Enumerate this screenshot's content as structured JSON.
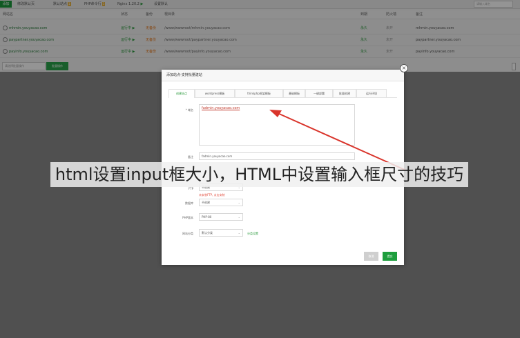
{
  "toolbar": {
    "add_label": "添加",
    "modify_label": "修改默认页",
    "default_site_label": "默认站点",
    "default_site_badge": "1",
    "php_cli_label": "PHP命令行",
    "php_cli_badge": "1",
    "nginx_label": "Nginx 1.20.2",
    "nginx_status": "▶",
    "set_default_label": "设置默认",
    "search_placeholder": "请输入域名"
  },
  "table": {
    "headers": {
      "site": "网站名",
      "status": "状态",
      "backup": "备份",
      "root": "根目录",
      "expire": "到期",
      "firewall": "防火墙",
      "remark": "备注"
    },
    "rows": [
      {
        "site": "mhmin.youyacao.com",
        "status": "运行中 ▶",
        "backup": "无备份",
        "root": "/www/wwwroot/mhmin.youyacao.com",
        "expire": "永久",
        "firewall": "未开",
        "remark": "mhmin.youyacao.com"
      },
      {
        "site": "paypartner.youyacao.com",
        "status": "运行中 ▶",
        "backup": "无备份",
        "root": "/www/wwwroot/paypartner.youyacao.com",
        "expire": "永久",
        "firewall": "未开",
        "remark": "paypartner.youyacao.com"
      },
      {
        "site": "payinfo.youyacao.com",
        "status": "运行中 ▶",
        "backup": "无备份",
        "root": "/www/wwwroot/payinfo.youyacao.com",
        "expire": "永久",
        "firewall": "未开",
        "remark": "payinfo.youyacao.com"
      }
    ]
  },
  "bottom": {
    "batch_select_placeholder": "请选择批量操作",
    "batch_button": "批量操作"
  },
  "modal": {
    "title": "添加站点-支持批量建站",
    "close_glyph": "×",
    "tabs": [
      "创建站点",
      "wordpress模板",
      "thinkphp框架模板",
      "基础模板",
      "一键部署",
      "批量创建",
      "运行环境"
    ],
    "labels": {
      "domain": "* 域名",
      "remark": "备注",
      "ftp": "FTP",
      "database": "数据库",
      "php_version": "PHP版本",
      "site_category": "网站分类"
    },
    "domain_value": "fadmin.youyacao.com",
    "remark_value": "fadmin.youyacao.com",
    "ftp_value": "不创建",
    "ftp_hint": "未安装FTP, 点击安装",
    "database_value": "不创建",
    "php_value": "PHP-80",
    "category_value": "默认分类",
    "category_link": "分类设置",
    "cancel_label": "取消",
    "submit_label": "提交",
    "dropdown_glyph": "⌄"
  },
  "caption": "html设置input框大小，HTML中设置输入框尺寸的技巧",
  "colors": {
    "accent_green": "#1e9e3d",
    "warning_red": "#e24a3b",
    "arrow_red": "#d9342b"
  }
}
